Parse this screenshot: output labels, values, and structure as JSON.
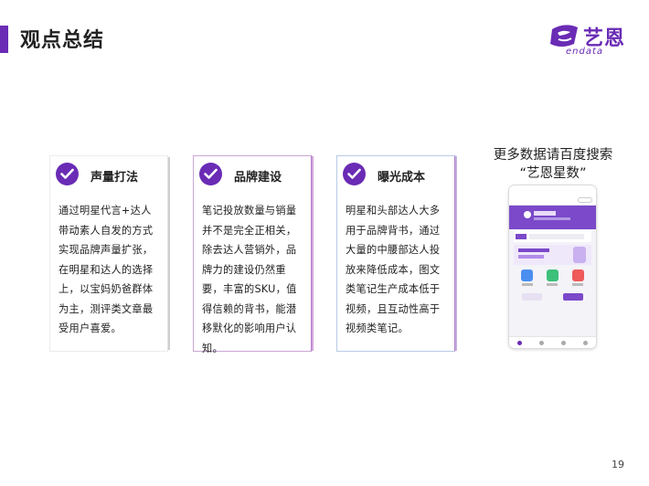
{
  "page": {
    "title": "观点总结",
    "page_number": "19"
  },
  "logo": {
    "name_cn": "艺恩",
    "name_en": "endata"
  },
  "cards": [
    {
      "title": "声量打法",
      "body": "通过明星代言+达人带动素人自发的方式实现品牌声量扩张，在明星和达人的选择上，以宝妈奶爸群体为主，测评类文章最受用户喜爱。"
    },
    {
      "title": "品牌建设",
      "body": "笔记投放数量与销量并不是完全正相关，除去达人营销外，品牌力的建设仍然重要，丰富的SKU，值得信赖的背书，能潜移默化的影响用户认知。"
    },
    {
      "title": "曝光成本",
      "body": "明星和头部达人大多用于品牌背书，通过大量的中腰部达人投放来降低成本，图文类笔记生产成本低于视频，且互动性高于视频类笔记。"
    }
  ],
  "promo": {
    "line1": "更多数据请百度搜索",
    "line2": "“艺恩星数”"
  },
  "colors": {
    "brand": "#6a2bb5",
    "phone_banner": "#7b49c9"
  },
  "icons": {
    "card_marker": "check-circle-icon",
    "logo_mark": "endata-logo-icon"
  }
}
